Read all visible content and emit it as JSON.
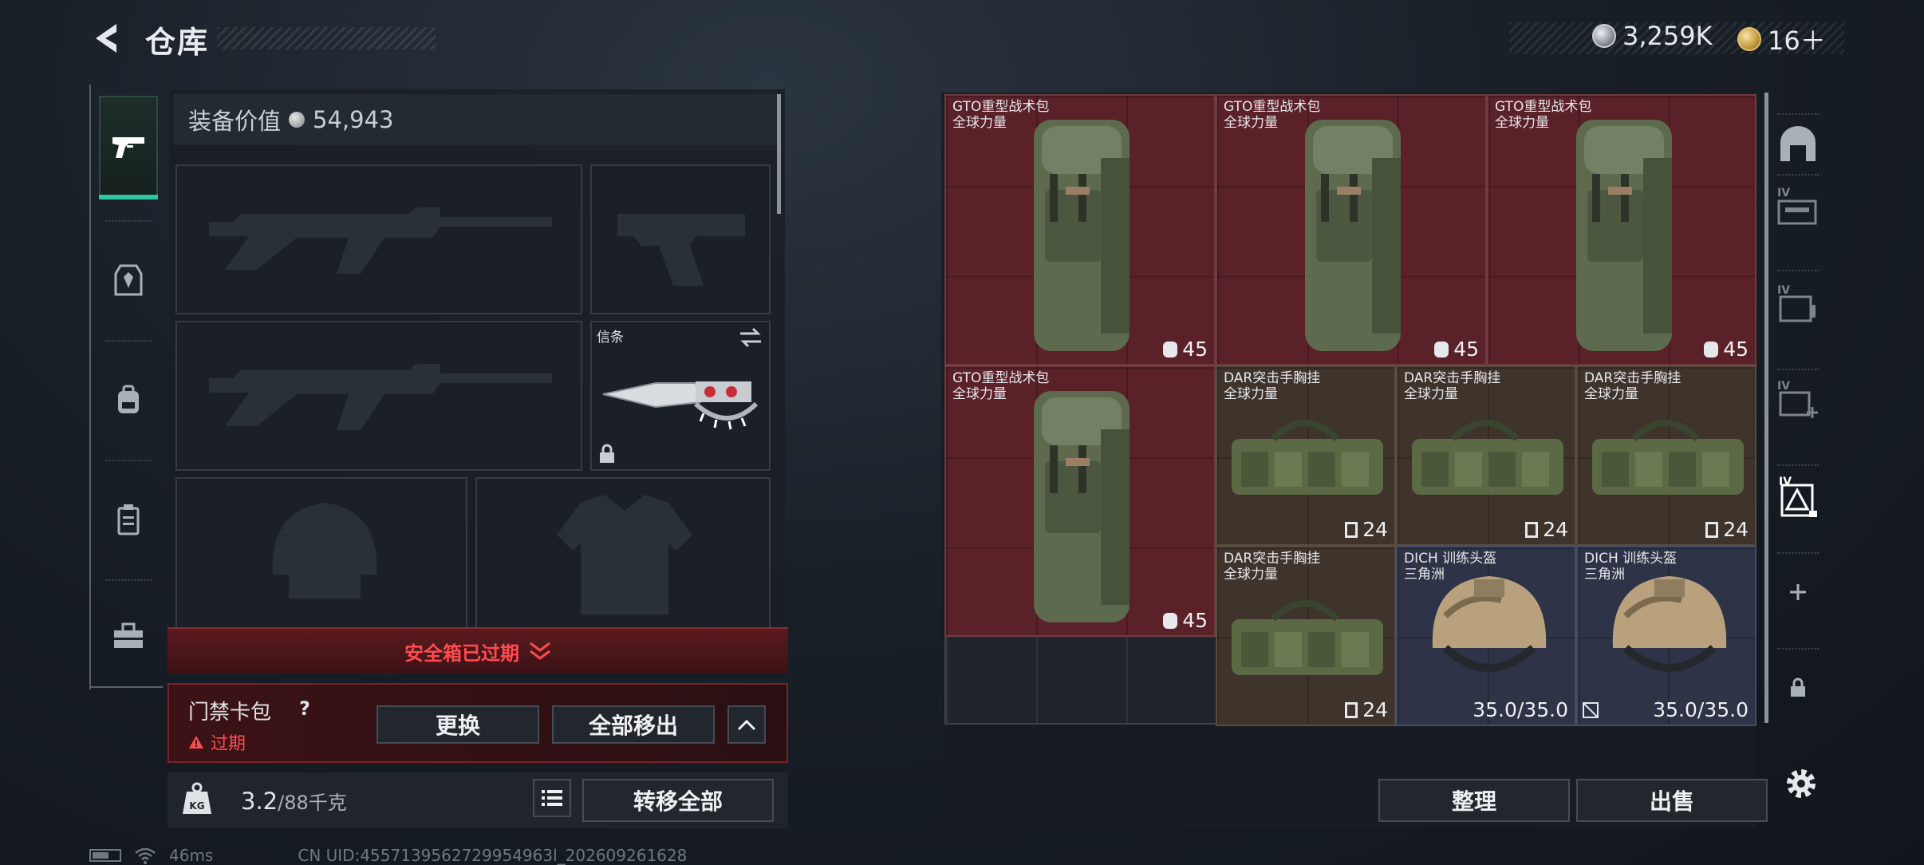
{
  "header": {
    "title": "仓库",
    "currencies": [
      {
        "icon": "silver-coin-icon",
        "value": "3,259K"
      },
      {
        "icon": "gold-coin-icon",
        "value": "16＋"
      }
    ]
  },
  "left_tabs": [
    {
      "icon": "pistol-icon",
      "active": true
    },
    {
      "icon": "chest-rig-icon",
      "active": false
    },
    {
      "icon": "backpack-icon",
      "active": false
    },
    {
      "icon": "container-icon",
      "active": false
    },
    {
      "icon": "toolbox-icon",
      "active": false
    }
  ],
  "equipment": {
    "value_label": "装备价值",
    "value": "54,943",
    "melee_label": "信条",
    "safe_box_status": "安全箱已过期",
    "keycard": {
      "label": "门禁卡包",
      "help": "?",
      "status": "过期",
      "replace_button": "更换",
      "remove_all_button": "全部移出"
    },
    "weight": {
      "current": "3.2",
      "max": "/88千克"
    },
    "transfer_all_button": "转移全部"
  },
  "storage": {
    "items": [
      {
        "name": "GTO重型战术包",
        "sub": "全球力量",
        "stat": "45",
        "type": "backpack",
        "rarity": "red"
      },
      {
        "name": "GTO重型战术包",
        "sub": "全球力量",
        "stat": "45",
        "type": "backpack",
        "rarity": "red"
      },
      {
        "name": "GTO重型战术包",
        "sub": "全球力量",
        "stat": "45",
        "type": "backpack",
        "rarity": "red"
      },
      {
        "name": "GTO重型战术包",
        "sub": "全球力量",
        "stat": "45",
        "type": "backpack",
        "rarity": "red"
      },
      {
        "name": "DAR突击手胸挂",
        "sub": "全球力量",
        "stat": "24",
        "type": "rig",
        "rarity": "brown"
      },
      {
        "name": "DAR突击手胸挂",
        "sub": "全球力量",
        "stat": "24",
        "type": "rig",
        "rarity": "brown"
      },
      {
        "name": "DAR突击手胸挂",
        "sub": "全球力量",
        "stat": "24",
        "type": "rig",
        "rarity": "brown"
      },
      {
        "name": "DAR突击手胸挂",
        "sub": "全球力量",
        "stat": "24",
        "type": "rig",
        "rarity": "brown"
      },
      {
        "name": "DICH 训练头盔",
        "sub": "三角洲",
        "stat": "35.0/35.0",
        "type": "helmet",
        "rarity": "blue"
      },
      {
        "name": "DICH 训练头盔",
        "sub": "三角洲",
        "stat": "35.0/35.0",
        "type": "helmet",
        "rarity": "blue"
      }
    ],
    "sort_button": "整理",
    "sell_button": "出售"
  },
  "right_rail": {
    "icons": [
      "storage-home-icon",
      "case-tier-iv-icon",
      "case-tier-iv-icon",
      "case-tier-iv-add-icon",
      "case-tier-iv-selected-icon",
      "plus-icon",
      "lock-icon"
    ],
    "tier_label": "IV"
  },
  "footer": {
    "ping": "46ms",
    "uid": "CN UID:4557139562729954963l_202609261628"
  },
  "colors": {
    "accent_green": "#2ec59f",
    "rarity_red": "#5a2129",
    "rarity_brown": "#3f342c",
    "rarity_blue": "#2e3347",
    "warning_red": "#ff4a4f"
  }
}
